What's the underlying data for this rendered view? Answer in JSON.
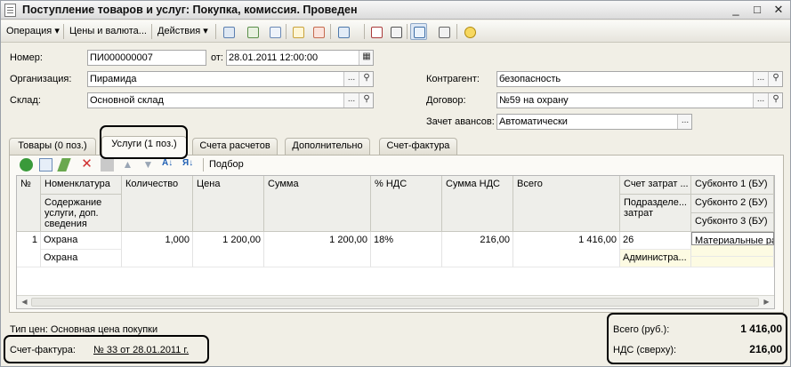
{
  "window": {
    "title": "Поступление товаров и услуг: Покупка, комиссия. Проведен",
    "btn_minimize": "_",
    "btn_maximize": "□",
    "btn_close": "✕"
  },
  "toolbar": {
    "operation_label": "Операция ▾",
    "prices_label": "Цены и валюта...",
    "actions_label": "Действия ▾",
    "icons": [
      "new-document-icon",
      "copy-icon",
      "add-icon",
      "post-icon",
      "unpost-icon",
      "go-to-icon",
      "dt-kt-icon",
      "journal-icon",
      "structure-icon",
      "list-icon",
      "help-icon"
    ]
  },
  "header": {
    "number_label": "Номер:",
    "number_value": "ПИ000000007",
    "date_label": "от:",
    "date_value": "28.01.2011 12:00:00",
    "organization_label": "Организация:",
    "organization_value": "Пирамида",
    "warehouse_label": "Склад:",
    "warehouse_value": "Основной склад",
    "counterparty_label": "Контрагент:",
    "counterparty_value": "безопасность",
    "contract_label": "Договор:",
    "contract_value": "№59 на охрану",
    "advance_label": "Зачет авансов:",
    "advance_value": "Автоматически",
    "select_glyph": "...",
    "search_glyph": "🔍"
  },
  "tabs": [
    {
      "label": "Товары (0 поз.)"
    },
    {
      "label": "Услуги (1 поз.)"
    },
    {
      "label": "Счета расчетов"
    },
    {
      "label": "Дополнительно"
    },
    {
      "label": "Счет-фактура"
    }
  ],
  "subtoolbar": {
    "selection_label": "Подбор"
  },
  "table": {
    "headers": {
      "num": "№",
      "nomenclature": "Номенклатура",
      "content": "Содержание услуги, доп. сведения",
      "quantity": "Количество",
      "price": "Цена",
      "sum": "Сумма",
      "vat_rate": "% НДС",
      "vat_sum": "Сумма НДС",
      "total": "Всего",
      "cost_account": "Счет затрат ...",
      "cost_division": "Подразделе... затрат",
      "subconto1": "Субконто 1 (БУ)",
      "subconto2": "Субконто 2 (БУ)",
      "subconto3": "Субконто 3 (БУ)"
    },
    "rows": [
      {
        "num": "1",
        "nomenclature": "Охрана",
        "content": "Охрана",
        "quantity": "1,000",
        "price": "1 200,00",
        "sum": "1 200,00",
        "vat_rate": "18%",
        "vat_sum": "216,00",
        "total": "1 416,00",
        "cost_account": "26",
        "cost_division": "Администра...",
        "subconto1": "Материальные расход"
      }
    ]
  },
  "footer": {
    "price_type": "Тип цен: Основная цена покупки",
    "invoice_label": "Счет-фактура:",
    "invoice_value": "№ 33 от 28.01.2011 г.",
    "total_label": "Всего (руб.):",
    "total_value": "1 416,00",
    "vat_label": "НДС (сверху):",
    "vat_value": "216,00"
  },
  "colors": {
    "accent": "#1f5fb4",
    "highlight_border": "#000000"
  }
}
